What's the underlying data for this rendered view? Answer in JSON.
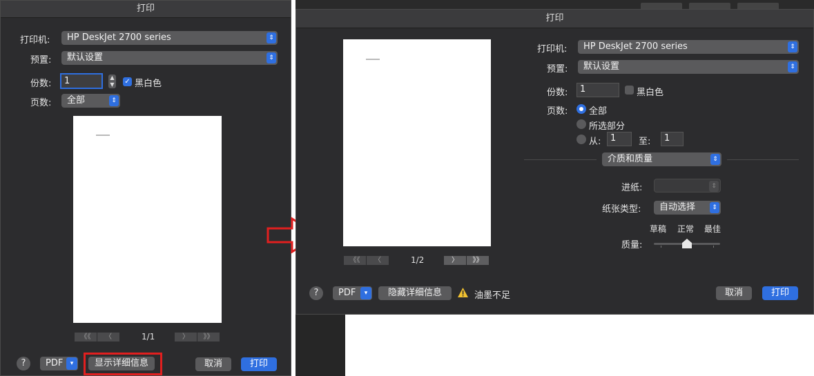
{
  "left_dialog": {
    "title": "打印",
    "printer_label": "打印机:",
    "printer_value": "HP DeskJet 2700 series",
    "presets_label": "预置:",
    "presets_value": "默认设置",
    "copies_label": "份数:",
    "copies_value": "1",
    "bw_label": "黑白色",
    "bw_checked": true,
    "pages_label": "页数:",
    "pages_value": "全部",
    "page_indicator": "1/1",
    "help_label": "?",
    "pdf_label": "PDF",
    "show_details_label": "显示详细信息",
    "cancel_label": "取消",
    "print_label": "打印"
  },
  "right_dialog": {
    "title": "打印",
    "printer_label": "打印机:",
    "printer_value": "HP DeskJet 2700 series",
    "presets_label": "预置:",
    "presets_value": "默认设置",
    "copies_label": "份数:",
    "copies_value": "1",
    "bw_label": "黑白色",
    "bw_checked": false,
    "pages_label": "页数:",
    "pages_all": "全部",
    "pages_selection": "所选部分",
    "pages_from": "从:",
    "pages_from_value": "1",
    "pages_to": "至:",
    "pages_to_value": "1",
    "section_value": "介质和质量",
    "feed_label": "进纸:",
    "feed_value": "",
    "paper_type_label": "纸张类型:",
    "paper_type_value": "自动选择",
    "quality_label": "质量:",
    "quality_draft": "草稿",
    "quality_normal": "正常",
    "quality_best": "最佳",
    "page_indicator": "1/2",
    "help_label": "?",
    "pdf_label": "PDF",
    "hide_details_label": "隐藏详细信息",
    "warning_text": "油墨不足",
    "cancel_label": "取消",
    "print_label": "打印"
  },
  "nav_glyphs": {
    "first": "《《",
    "prev": "〈",
    "next": "〉",
    "last": "》》"
  },
  "colors": {
    "accent": "#2f6fe0",
    "dialog_bg": "#2c2c2e",
    "highlight": "#e11f1f",
    "warning": "#f2c230"
  }
}
